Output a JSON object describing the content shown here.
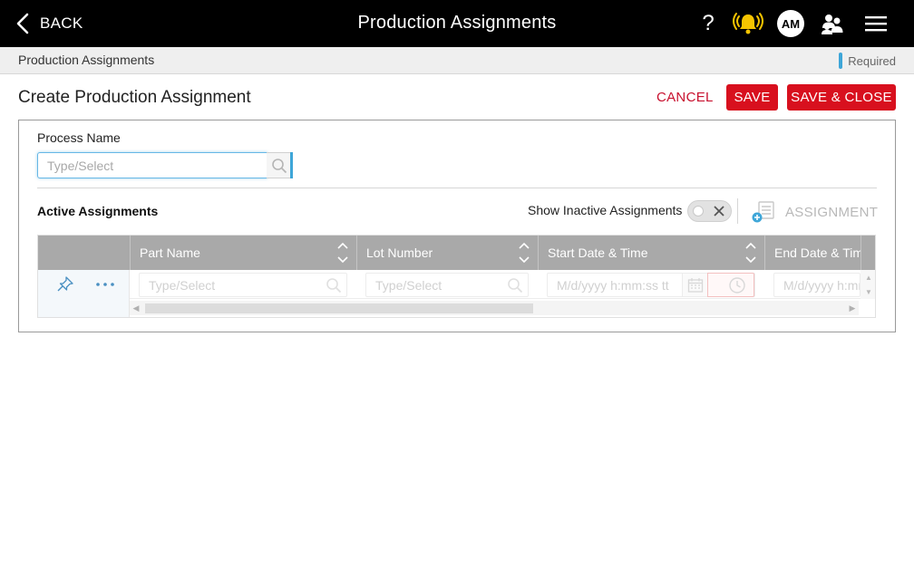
{
  "header": {
    "back_label": "BACK",
    "title": "Production Assignments",
    "help_label": "?",
    "avatar_initials": "AM",
    "icons": [
      "chevron-left-icon",
      "alarm-bell-icon",
      "people-icon",
      "hamburger-menu-icon"
    ],
    "bell_color": "#f5c400"
  },
  "breadcrumb": {
    "label": "Production Assignments",
    "required_label": "Required",
    "required_color": "#3ea6d8"
  },
  "page": {
    "title": "Create Production Assignment",
    "cancel_label": "CANCEL",
    "save_label": "SAVE",
    "save_close_label": "SAVE & CLOSE",
    "accent_color": "#d8101e"
  },
  "form": {
    "process_label": "Process Name",
    "process_placeholder": "Type/Select",
    "process_value": ""
  },
  "assignments": {
    "title": "Active Assignments",
    "show_inactive_label": "Show Inactive Assignments",
    "show_inactive": false,
    "add_label": "ASSIGNMENT",
    "columns": [
      {
        "label": "Part Name"
      },
      {
        "label": "Lot Number"
      },
      {
        "label": "Start Date & Time"
      },
      {
        "label": "End Date & Time"
      }
    ],
    "new_row": {
      "part_placeholder": "Type/Select",
      "lot_placeholder": "Type/Select",
      "start_placeholder": "M/d/yyyy h:mm:ss tt",
      "end_placeholder": "M/d/yyyy h:mm:ss tt"
    }
  }
}
